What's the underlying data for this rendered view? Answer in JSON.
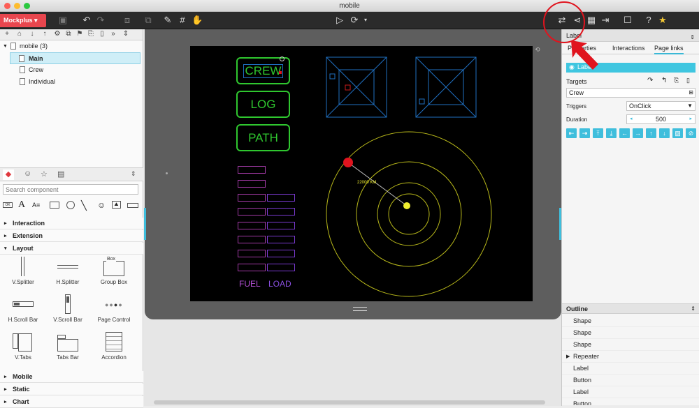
{
  "window": {
    "title": "mobile"
  },
  "toolbar": {
    "brand": "Mockplus ▾"
  },
  "tree": {
    "root": "mobile (3)",
    "pages": [
      "Main",
      "Crew",
      "Individual"
    ],
    "selected": "Main"
  },
  "components": {
    "search_placeholder": "Search component",
    "categories": [
      "Interaction",
      "Extension",
      "Layout",
      "Mobile",
      "Static",
      "Chart"
    ],
    "layout_items": [
      "V.Splitter",
      "H.Splitter",
      "Group Box",
      "H.Scroll Bar",
      "V.Scroll Bar",
      "Page Control",
      "V.Tabs",
      "Tabs Bar",
      "Accordion"
    ],
    "groupbox_caption": "Box"
  },
  "mockup": {
    "buttons": [
      "CREW",
      "LOG",
      "PATH"
    ],
    "fuel_label": "FUEL",
    "load_label": "LOAD",
    "distance_label": "22000 KM",
    "colors": {
      "green": "#2fc72f",
      "blue": "#1f6fc0",
      "yellow": "#b8b81a",
      "red": "#e0141e",
      "purple": "#a23aa6"
    }
  },
  "inspector": {
    "title": "Label",
    "tabs": [
      "Properties",
      "Interactions",
      "Page links"
    ],
    "active_tab": "Page links",
    "selected_link": "Label",
    "targets_label": "Targets",
    "target_value": "Crew",
    "triggers_label": "Triggers",
    "trigger_value": "OnClick",
    "duration_label": "Duration",
    "duration_value": "500"
  },
  "outline": {
    "title": "Outline",
    "items": [
      "Shape",
      "Shape",
      "Shape",
      "Repeater",
      "Label",
      "Button",
      "Label",
      "Button"
    ]
  }
}
